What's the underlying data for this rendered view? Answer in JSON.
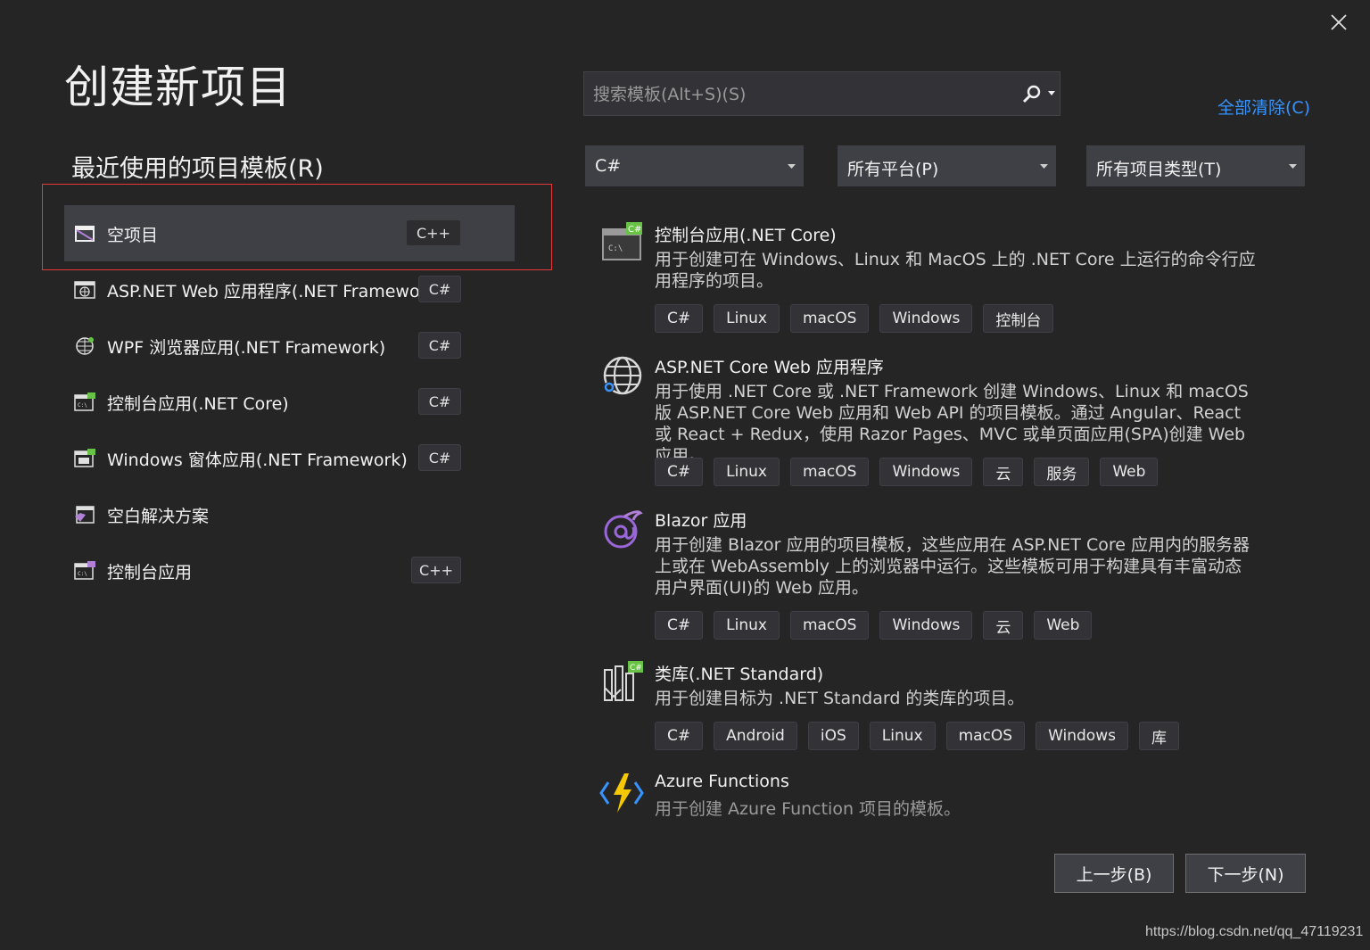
{
  "window": {
    "title": "创建新项目",
    "close_icon": "close-icon"
  },
  "recent": {
    "heading": "最近使用的项目模板(R)",
    "items": [
      {
        "label": "空项目",
        "badge": "C++",
        "icon": "empty-project-icon",
        "selected": true
      },
      {
        "label": "ASP.NET Web 应用程序(.NET Framework)",
        "badge": "C#",
        "icon": "web-app-icon"
      },
      {
        "label": "WPF 浏览器应用(.NET Framework)",
        "badge": "C#",
        "icon": "wpf-browser-icon"
      },
      {
        "label": "控制台应用(.NET Core)",
        "badge": "C#",
        "icon": "console-csharp-icon"
      },
      {
        "label": "Windows 窗体应用(.NET Framework)",
        "badge": "C#",
        "icon": "winforms-icon"
      },
      {
        "label": "空白解决方案",
        "badge": "",
        "icon": "blank-solution-icon"
      },
      {
        "label": "控制台应用",
        "badge": "C++",
        "icon": "console-cpp-icon"
      }
    ]
  },
  "search": {
    "placeholder": "搜索模板(Alt+S)(S)",
    "value": ""
  },
  "clear_all": "全部清除(C)",
  "filters": {
    "language": "C#",
    "platform": "所有平台(P)",
    "project_type": "所有项目类型(T)"
  },
  "templates": [
    {
      "name": "控制台应用(.NET Core)",
      "desc": "用于创建可在 Windows、Linux 和 MacOS 上的 .NET Core 上运行的命令行应用程序的项目。",
      "tags": [
        "C#",
        "Linux",
        "macOS",
        "Windows",
        "控制台"
      ],
      "icon": "console-app-icon"
    },
    {
      "name": "ASP.NET Core Web 应用程序",
      "desc": "用于使用 .NET Core 或 .NET Framework 创建 Windows、Linux 和 macOS 版 ASP.NET Core Web 应用和 Web API 的项目模板。通过 Angular、React 或 React + Redux，使用 Razor Pages、MVC 或单页面应用(SPA)创建 Web 应用。",
      "tags": [
        "C#",
        "Linux",
        "macOS",
        "Windows",
        "云",
        "服务",
        "Web"
      ],
      "icon": "globe-icon"
    },
    {
      "name": "Blazor 应用",
      "desc": "用于创建 Blazor 应用的项目模板，这些应用在 ASP.NET Core 应用内的服务器上或在 WebAssembly 上的浏览器中运行。这些模板可用于构建具有丰富动态用户界面(UI)的 Web 应用。",
      "tags": [
        "C#",
        "Linux",
        "macOS",
        "Windows",
        "云",
        "Web"
      ],
      "icon": "blazor-icon"
    },
    {
      "name": "类库(.NET Standard)",
      "desc": "用于创建目标为 .NET Standard 的类库的项目。",
      "tags": [
        "C#",
        "Android",
        "iOS",
        "Linux",
        "macOS",
        "Windows",
        "库"
      ],
      "icon": "class-library-icon"
    },
    {
      "name": "Azure Functions",
      "desc": "用于创建 Azure Function 项目的模板。",
      "tags": [],
      "icon": "azure-functions-icon"
    }
  ],
  "buttons": {
    "back": "上一步(B)",
    "next": "下一步(N)"
  },
  "watermark": "https://blog.csdn.net/qq_47119231",
  "colors": {
    "background": "#252526",
    "accent_link": "#3794ff",
    "selection_outline": "#e03a3a",
    "csharp_badge": "#68c245"
  }
}
